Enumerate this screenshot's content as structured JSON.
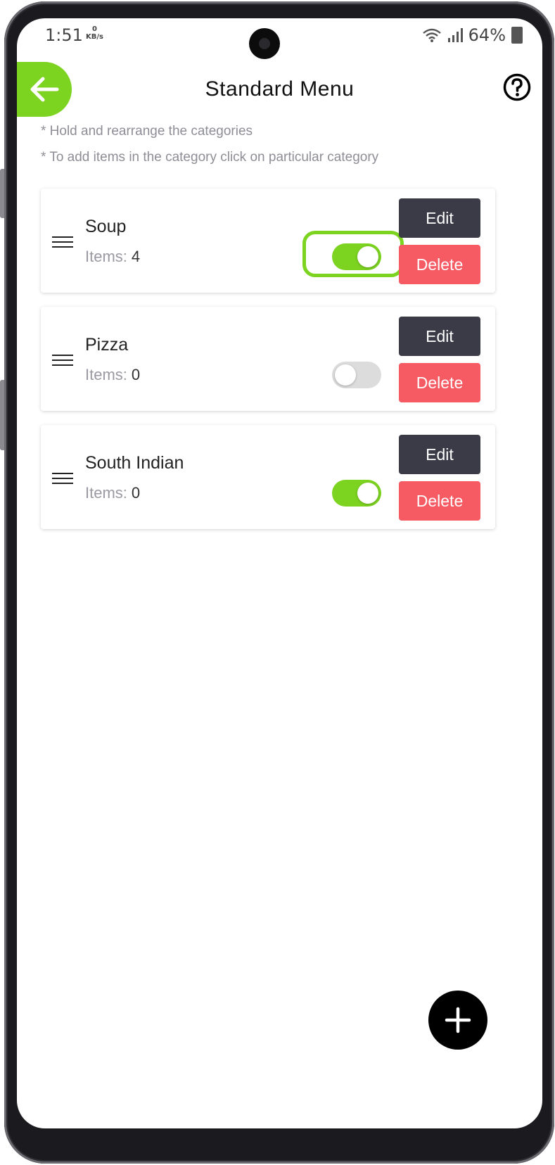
{
  "status_bar": {
    "time": "1:51",
    "speed_value": "0",
    "speed_unit": "KB/s",
    "battery": "64%"
  },
  "header": {
    "title": "Standard Menu",
    "back_icon": "arrow-left-icon",
    "help_icon": "question-circle-icon"
  },
  "hints": [
    "* Hold and rearrange the categories",
    "* To add items in the category click on particular category"
  ],
  "categories": [
    {
      "name": "Soup",
      "items_label": "Items:",
      "items_count": "4",
      "enabled": true,
      "highlighted": true,
      "edit_label": "Edit",
      "delete_label": "Delete"
    },
    {
      "name": "Pizza",
      "items_label": "Items:",
      "items_count": "0",
      "enabled": false,
      "highlighted": false,
      "edit_label": "Edit",
      "delete_label": "Delete"
    },
    {
      "name": "South Indian",
      "items_label": "Items:",
      "items_count": "0",
      "enabled": true,
      "highlighted": false,
      "edit_label": "Edit",
      "delete_label": "Delete"
    }
  ],
  "fab_icon": "plus-icon",
  "colors": {
    "accent_green": "#7cd320",
    "edit_button": "#3b3b47",
    "delete_button": "#f65a62",
    "toggle_off": "#dcdcdc"
  }
}
